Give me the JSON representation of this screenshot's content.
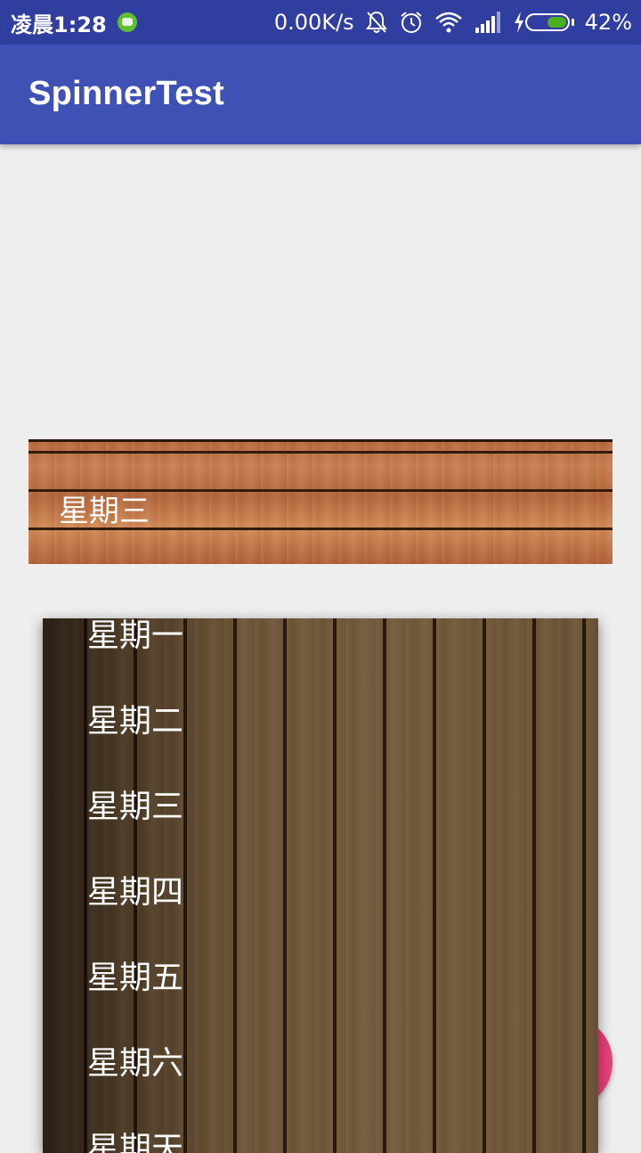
{
  "status_bar": {
    "time": "凌晨1:28",
    "net_speed": "0.00K/s",
    "battery": "42%",
    "battery_level": 0.42,
    "icons": [
      "app-notification-icon",
      "mute-bell-icon",
      "alarm-icon",
      "wifi-icon",
      "signal-icon",
      "charging-icon",
      "battery-icon"
    ]
  },
  "app_bar": {
    "title": "SpinnerTest"
  },
  "spinner": {
    "selected": "星期三"
  },
  "dropdown": {
    "items": [
      {
        "label": "星期一"
      },
      {
        "label": "星期二"
      },
      {
        "label": "星期三"
      },
      {
        "label": "星期四"
      },
      {
        "label": "星期五"
      },
      {
        "label": "星期六"
      },
      {
        "label": "星期天"
      }
    ]
  },
  "colors": {
    "status_bar": "#303f9f",
    "primary": "#3f51b5",
    "accent": "#e9407c",
    "background": "#eeeeee"
  }
}
